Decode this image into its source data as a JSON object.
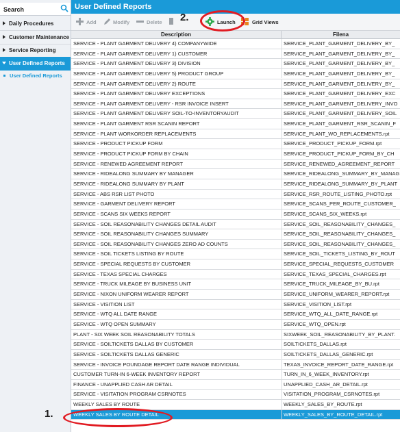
{
  "sidebar": {
    "search_label": "Search",
    "items": [
      {
        "label": "Daily Procedures"
      },
      {
        "label": "Customer Maintenance"
      },
      {
        "label": "Service Reporting"
      },
      {
        "label": "User Defined Reports"
      }
    ],
    "sub_item": "User Defined Reports"
  },
  "title": "User Defined Reports",
  "toolbar": {
    "add": "Add",
    "modify": "Modify",
    "delete": "Delete",
    "launch": "Launch",
    "grid_views": "Grid Views"
  },
  "annotations": {
    "step1": "1.",
    "step2": "2."
  },
  "grid": {
    "columns": [
      "Description",
      "Filena"
    ],
    "rows": [
      [
        "SERVICE - PLANT GARMENT DELIVERY 4) COMPANYWIDE",
        "SERVICE_PLANT_GARMENT_DELIVERY_BY_"
      ],
      [
        "SERVICE - PLANT GARMENT DELIVERY 1) CUSTOMER",
        "SERVICE_PLANT_GARMENT_DELIVERY_BY_"
      ],
      [
        "SERVICE - PLANT GARMENT DELIVERY 3) DIVISION",
        "SERVICE_PLANT_GARMENT_DELIVERY_BY_"
      ],
      [
        "SERVICE - PLANT GARMENT DELIVERY 5) PRODUCT GROUP",
        "SERVICE_PLANT_GARMENT_DELIVERY_BY_"
      ],
      [
        "SERVICE - PLANT GARMENT DELIVERY 2) ROUTE",
        "SERVICE_PLANT_GARMENT_DELIVERY_BY_"
      ],
      [
        "SERVICE - PLANT GARMENT DELIVERY EXCEPTIONS",
        "SERVICE_PLANT_GARMENT_DELIVERY_EXC"
      ],
      [
        "SERVICE - PLANT GARMENT DELIVERY - RSR INVOICE INSERT",
        "SERVICE_PLANT_GARMENT_DELIVERY_INVO"
      ],
      [
        "SERVICE - PLANT GARMENT DELIVERY SOIL-TO-INVENTORYAUDIT",
        "SERVICE_PLANT_GARMENT_DELIVERY_SOIL"
      ],
      [
        "SERVICE - PLANT GARMENT RSR SCANIN REPORT",
        "SERVICE_PLANT_GARMENT_RSR_SCANIN_F"
      ],
      [
        "SERVICE - PLANT WORKORDER REPLACEMENTS",
        "SERVICE_PLANT_WO_REPLACEMENTS.rpt"
      ],
      [
        "SERVICE - PRODUCT PICKUP FORM",
        "SERVICE_PRODUCT_PICKUP_FORM.rpt"
      ],
      [
        "SERVICE - PRODUCT PICKUP FORM BY CHAIN",
        "SERVICE_PRODUCT_PICKUP_FORM_BY_CH"
      ],
      [
        "SERVICE - RENEWED AGREEMENT REPORT",
        "SERVICE_RENEWED_AGREEMENT_REPORT"
      ],
      [
        "SERVICE - RIDEALONG SUMMARY BY MANAGER",
        "SERVICE_RIDEALONG_SUMMARY_BY_MANAG"
      ],
      [
        "SERVICE - RIDEALONG SUMMARY BY PLANT",
        "SERVICE_RIDEALONG_SUMMARY_BY_PLANT"
      ],
      [
        "SERVICE - ABS RSR LIST PHOTO",
        "SERVICE_RSR_ROUTE_LISTING_PHOTO.rpt"
      ],
      [
        "SERVICE - GARMENT DELIVERY REPORT",
        "SERVICE_SCANS_PER_ROUTE_CUSTOMER_"
      ],
      [
        "SERVICE - SCANS SIX WEEKS REPORT",
        "SERVICE_SCANS_SIX_WEEKS.rpt"
      ],
      [
        "SERVICE - SOIL REASONABILITY CHANGES DETAIL AUDIT",
        "SERVICE_SOIL_REASONABILITY_CHANGES_"
      ],
      [
        "SERVICE - SOIL REASONABILITY CHANGES SUMMARY",
        "SERVICE_SOIL_REASONABILITY_CHANGES_"
      ],
      [
        "SERVICE - SOIL REASONABILITY CHANGES ZERO AD COUNTS",
        "SERVICE_SOIL_REASONABILITY_CHANGES_"
      ],
      [
        "SERVICE - SOIL TICKETS LISTING BY ROUTE",
        "SERVICE_SOIL_TICKETS_LISTING_BY_ROUT"
      ],
      [
        "SERVICE - SPECIAL REQUESTS BY CUSTOMER",
        "SERVICE_SPECIAL_REQUESTS_CUSTOMER"
      ],
      [
        "SERVICE - TEXAS SPECIAL CHARGES",
        "SERVICE_TEXAS_SPECIAL_CHARGES.rpt"
      ],
      [
        "SERVICE - TRUCK MILEAGE BY BUSINESS UNIT",
        "SERVICE_TRUCK_MILEAGE_BY_BU.rpt"
      ],
      [
        "SERVICE - NIXON UNIFORM WEARER REPORT",
        "SERVICE_UNIFORM_WEARER_REPORT.rpt"
      ],
      [
        "SERVICE - VISITION LIST",
        "SERVICE_VISITION_LIST.rpt"
      ],
      [
        "SERVICE - WTQ ALL DATE RANGE",
        "SERVICE_WTQ_ALL_DATE_RANGE.rpt"
      ],
      [
        "SERVICE - WTQ OPEN SUMMARY",
        "SERVICE_WTQ_OPEN.rpt"
      ],
      [
        "PLANT - SIX WEEK SOIL REASONABILITY TOTALS",
        "SIXWEEK_SOIL_REASONABILITY_BY_PLANT."
      ],
      [
        "SERVICE - SOILTICKETS DALLAS BY CUSTOMER",
        "SOILTICKETS_DALLAS.rpt"
      ],
      [
        "SERVICE - SOILTICKETS DALLAS GENERIC",
        "SOILTICKETS_DALLAS_GENERIC.rpt"
      ],
      [
        "SERVICE - INVOICE POUNDAGE REPORT DATE RANGE INDIVIDUAL",
        "TEXAS_INVOICE_REPORT_DATE_RANGE.rpt"
      ],
      [
        "CUSTOMER TURN-IN 6-WEEK INVENTORY REPORT",
        "TURN_IN_6_WEEK_INVENTORY.rpt"
      ],
      [
        "FINANCE - UNAPPLIED CASH AR DETAIL",
        "UNAPPLIED_CASH_AR_DETAIL.rpt"
      ],
      [
        "SERVICE - VISITATION PROGRAM CSRNOTES",
        "VISITATION_PROGRAM_CSRNOTES.rpt"
      ],
      [
        "WEEKLY SALES BY ROUTE",
        "WEEKLY_SALES_BY_ROUTE.rpt"
      ],
      [
        "WEEKLY SALES BY ROUTE DETAIL",
        "WEEKLY_SALES_BY_ROUTE_DETAIL.rpt"
      ]
    ],
    "selected_index": 37
  }
}
